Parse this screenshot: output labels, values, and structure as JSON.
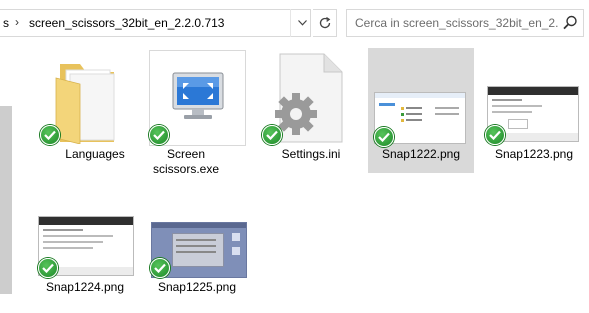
{
  "address_bar": {
    "crumb_prev": "s",
    "separator": "›",
    "crumb_current": "screen_scissors_32bit_en_2.2.0.713",
    "dropdown_glyph": "v",
    "refresh_glyph": "↻"
  },
  "search": {
    "placeholder": "Cerca in screen_scissors_32bit_en_2.2...",
    "icon": "search-icon"
  },
  "files": [
    {
      "name": "Languages",
      "kind": "folder",
      "selected": false,
      "sync_status": "check-icon"
    },
    {
      "name": "Screen scissors.exe",
      "line1": "Screen",
      "line2": "scissors.exe",
      "kind": "exe",
      "selected": false,
      "sync_status": "check-icon"
    },
    {
      "name": "Settings.ini",
      "kind": "ini",
      "selected": false,
      "sync_status": "check-icon"
    },
    {
      "name": "Snap1222.png",
      "kind": "png",
      "selected": true,
      "sync_status": "check-icon"
    },
    {
      "name": "Snap1223.png",
      "kind": "png",
      "selected": false,
      "sync_status": "check-icon"
    },
    {
      "name": "Snap1224.png",
      "kind": "png",
      "selected": false,
      "sync_status": "check-icon"
    },
    {
      "name": "Snap1225.png",
      "kind": "png",
      "selected": false,
      "sync_status": "check-icon"
    }
  ],
  "colors": {
    "selection": "#d9d9d9",
    "check_green": "#2ea043",
    "folder_yellow": "#f3d57a"
  }
}
